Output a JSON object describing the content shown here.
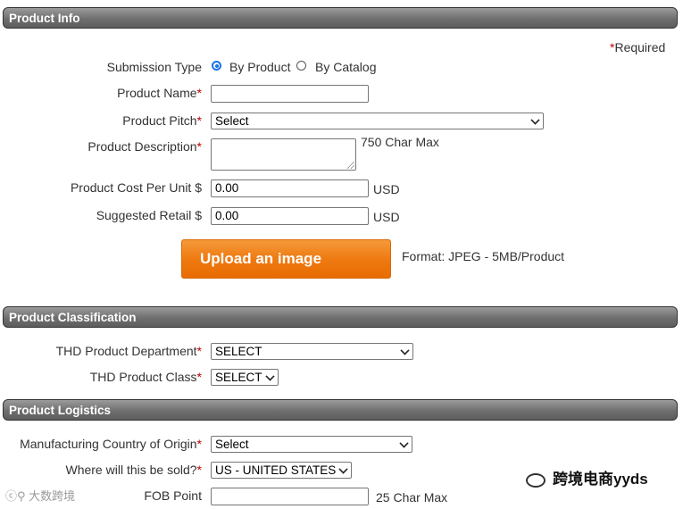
{
  "sections": {
    "product_info": "Product Info",
    "product_classification": "Product Classification",
    "product_logistics": "Product Logistics"
  },
  "required_note": "Required",
  "required_mark": "*",
  "submission_type": {
    "label": "Submission Type",
    "options": [
      "By Product",
      "By Catalog"
    ],
    "selected": "By Product"
  },
  "product_name": {
    "label": "Product Name",
    "value": ""
  },
  "product_pitch": {
    "label": "Product Pitch",
    "value": "Select"
  },
  "product_description": {
    "label": "Product Description",
    "hint": "750 Char Max",
    "value": ""
  },
  "cost_per_unit": {
    "label": "Product Cost Per Unit $",
    "value": "0.00",
    "unit": "USD"
  },
  "suggested_retail": {
    "label": "Suggested Retail $",
    "value": "0.00",
    "unit": "USD"
  },
  "upload": {
    "label": "Upload an image",
    "format": "Format: JPEG - 5MB/Product"
  },
  "thd_department": {
    "label": "THD Product Department",
    "value": "SELECT"
  },
  "thd_class": {
    "label": "THD Product Class",
    "value": "SELECT"
  },
  "country_of_origin": {
    "label": "Manufacturing Country of Origin",
    "value": "Select"
  },
  "where_sold": {
    "label": "Where will this be sold?",
    "value": "US - UNITED STATES"
  },
  "fob_point": {
    "label": "FOB Point",
    "value": "",
    "hint": "25 Char Max"
  },
  "watermarks": {
    "left": "大数跨境",
    "right": "跨境电商yyds"
  },
  "colors": {
    "accent": "#1a73e8",
    "upload_button": "#ef7a12",
    "required": "#c00000"
  }
}
